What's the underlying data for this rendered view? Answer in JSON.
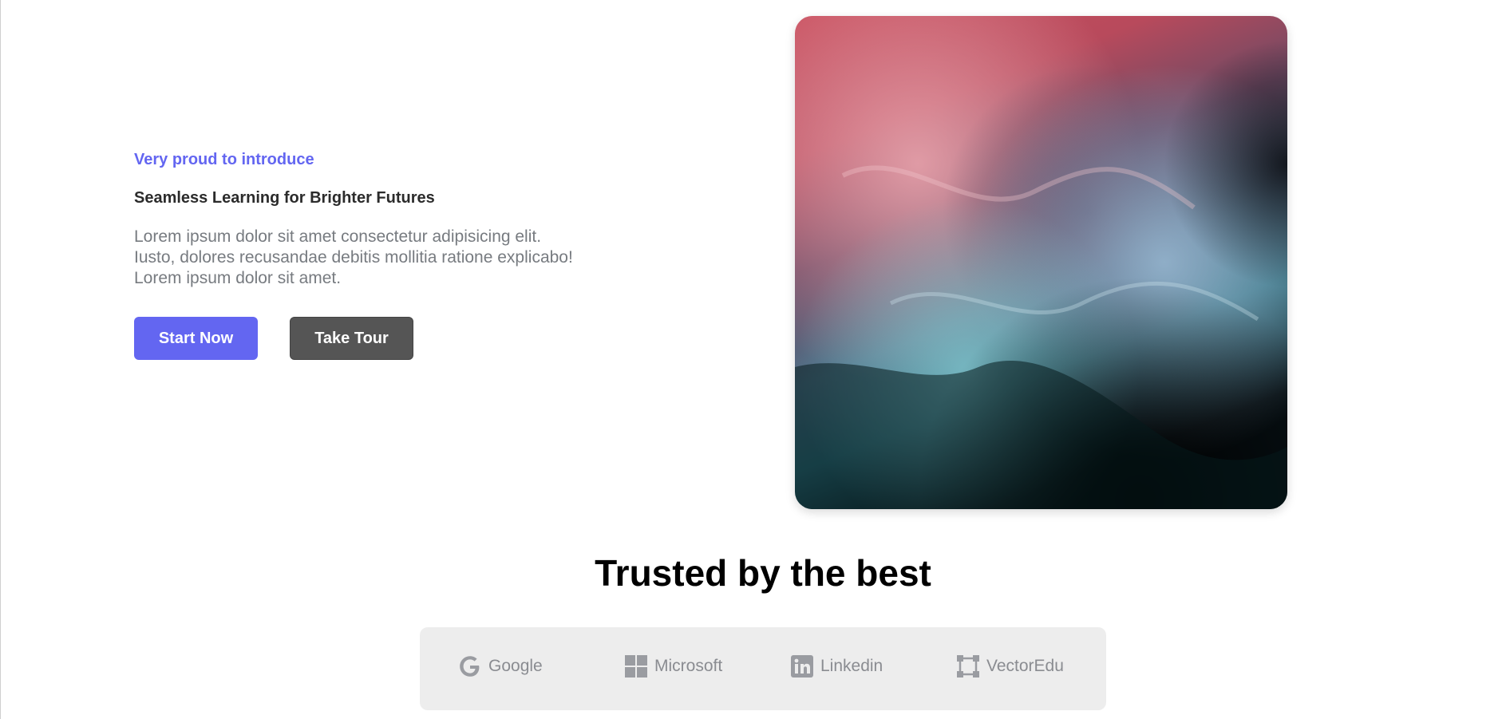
{
  "hero": {
    "eyebrow": "Very proud to introduce",
    "headline": "Seamless Learning for Brighter Futures",
    "body_line1": "Lorem ipsum dolor sit amet consectetur adipisicing elit.",
    "body_line2": "Iusto, dolores recusandae debitis mollitia ratione explicabo!",
    "body_line3": "Lorem ipsum dolor sit amet.",
    "primary_cta": "Start Now",
    "secondary_cta": "Take Tour",
    "image_icon": "abstract-fluid-art-image"
  },
  "trusted": {
    "title": "Trusted by the best",
    "logos": [
      {
        "name": "Google",
        "icon": "google-icon"
      },
      {
        "name": "Microsoft",
        "icon": "microsoft-icon"
      },
      {
        "name": "Linkedin",
        "icon": "linkedin-icon"
      },
      {
        "name": "VectorEdu",
        "icon": "vector-icon"
      }
    ]
  },
  "colors": {
    "accent": "#6366f1",
    "secondary_button": "#555555",
    "logo_bar_bg": "#ededed",
    "logo_text": "#8a8c91"
  }
}
